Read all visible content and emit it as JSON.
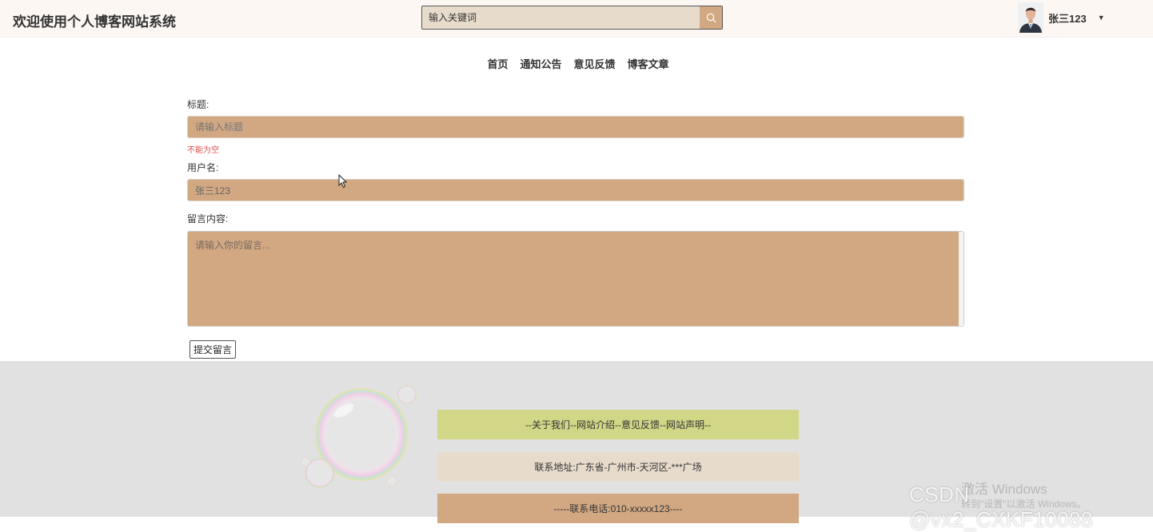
{
  "header": {
    "site_title": "欢迎使用个人博客网站系统",
    "search_placeholder": "输入关键词",
    "username": "张三123"
  },
  "nav": {
    "items": [
      "首页",
      "通知公告",
      "意见反馈",
      "博客文章"
    ]
  },
  "form": {
    "title_label": "标题:",
    "title_placeholder": "请输入标题",
    "title_error": "不能为空",
    "username_label": "用户名:",
    "username_value": "张三123",
    "content_label": "留言内容:",
    "content_placeholder": "请输入你的留言...",
    "submit_label": "提交留言"
  },
  "footer": {
    "links": "--关于我们--网站介绍--意见反馈--网站声明--",
    "address": "联系地址:广东省-广州市-天河区-***广场",
    "phone": "-----联系电话:010-xxxxx123----"
  },
  "overlay": {
    "activate_title": "激活 Windows",
    "activate_sub": "转到\"设置\"以激活 Windows。",
    "csdn_watermark": "CSDN @vx2_CXKF10088"
  },
  "colors": {
    "accent": "#d2a883",
    "search_bg": "#e7dccc",
    "footer_bar_1": "#d2d687",
    "footer_bg": "#e1e1e1",
    "error": "#d9534f"
  }
}
